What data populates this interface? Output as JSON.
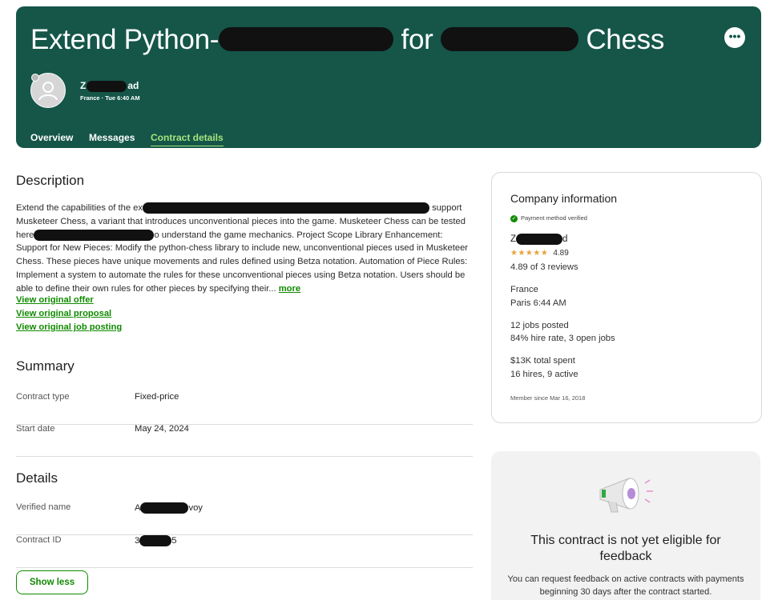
{
  "header": {
    "title_parts": [
      "Extend Python-",
      " for ",
      " Chess"
    ],
    "client_name_prefix": "Z",
    "client_name_suffix": "ad",
    "client_meta": "France · Tue 6:40 AM",
    "more_label": "•••",
    "tabs": [
      "Overview",
      "Messages",
      "Contract details"
    ],
    "active_tab": "Contract details"
  },
  "description": {
    "heading": "Description",
    "text_1": "Extend the capabilities of the ex",
    "text_2": " support Musketeer Chess, a variant that introduces unconventional pieces into the game. Musketeer Chess can be tested here",
    "text_3": "o understand the game mechanics. Project Scope Library Enhancement: Support for New Pieces: Modify the python-chess library to include new, unconventional pieces used in Musketeer Chess. These pieces have unique movements and rules defined using Betza notation. Automation of Piece Rules: Implement a system to automate the rules for these unconventional pieces using Betza notation. Users should be able to define their own rules for other pieces by specifying their...",
    "more_label": "more",
    "links": [
      "View original offer",
      "View original proposal",
      "View original job posting"
    ]
  },
  "summary": {
    "heading": "Summary",
    "rows": [
      {
        "key": "Contract type",
        "value": "Fixed-price"
      },
      {
        "key": "Start date",
        "value": "May 24, 2024"
      }
    ]
  },
  "details": {
    "heading": "Details",
    "verified_label": "Verified name",
    "verified_prefix": "A",
    "verified_suffix": "voy",
    "contract_label": "Contract ID",
    "contract_prefix": "3",
    "contract_suffix": "5",
    "show_less": "Show less"
  },
  "company": {
    "heading": "Company information",
    "payment": "Payment method verified",
    "name_prefix": "Z",
    "name_suffix": "d",
    "stars": "★★★★★",
    "rating": "4.89",
    "reviews": "4.89 of 3 reviews",
    "country": "France",
    "local_time": "Paris 6:44 AM",
    "jobs_posted": "12 jobs posted",
    "hire_rate": "84% hire rate, 3 open jobs",
    "total_spent": "$13K total spent",
    "hires": "16 hires, 9 active",
    "member_since": "Member since Mar 16, 2018"
  },
  "feedback": {
    "title": "This contract is not yet eligible for feedback",
    "body": "You can request feedback on active contracts with payments beginning 30 days after the contract started."
  },
  "colors": {
    "header_bg": "#155649",
    "accent": "#108a00",
    "active_tab": "#a6e27c"
  }
}
